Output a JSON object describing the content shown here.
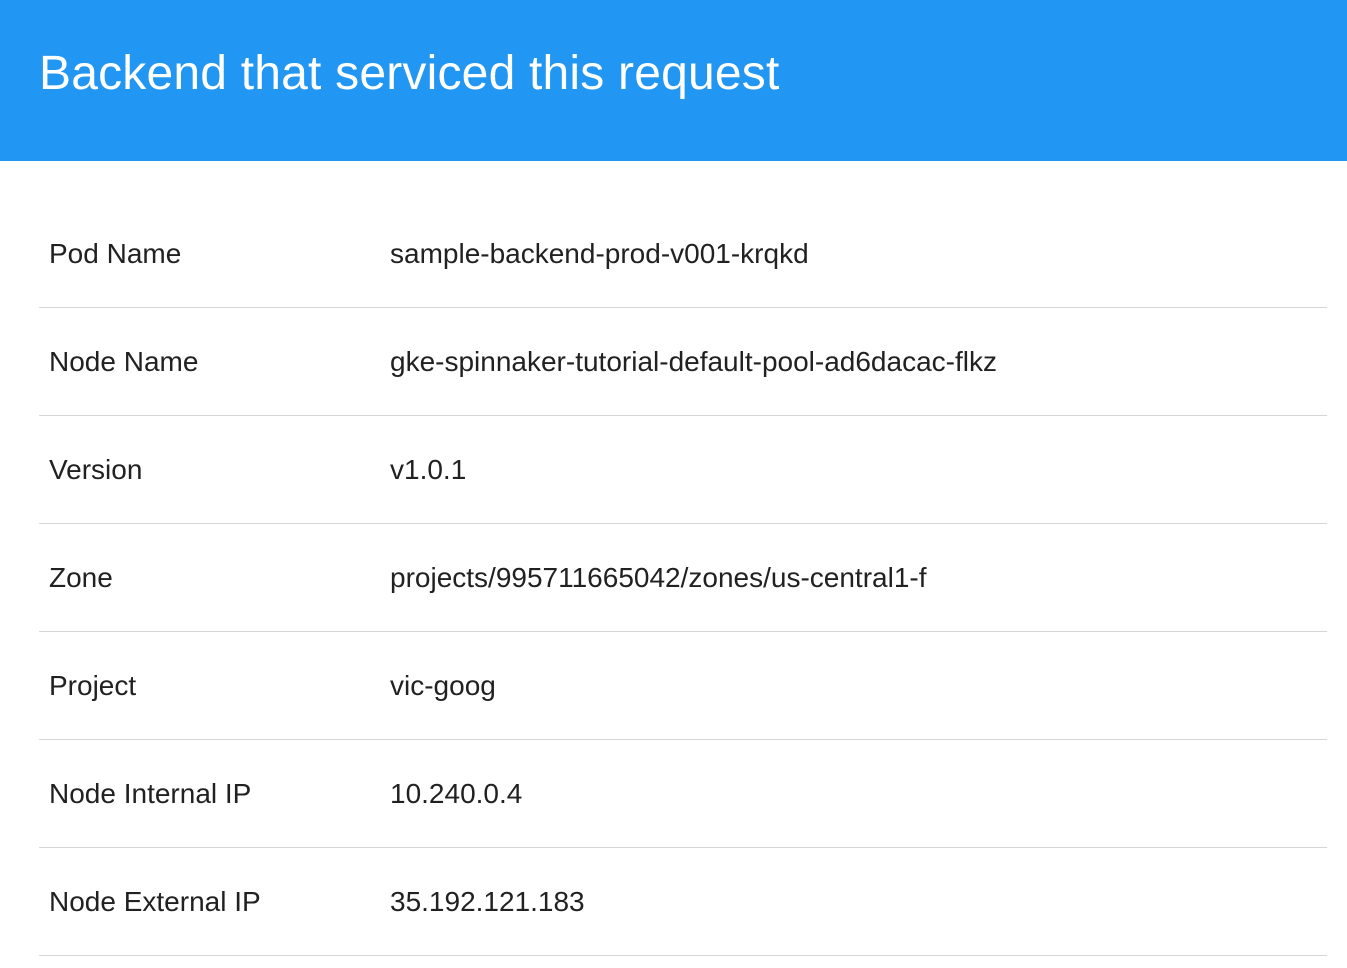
{
  "header": {
    "title": "Backend that serviced this request",
    "background_color": "#2196F3"
  },
  "details": {
    "rows": [
      {
        "label": "Pod Name",
        "value": "sample-backend-prod-v001-krqkd"
      },
      {
        "label": "Node Name",
        "value": "gke-spinnaker-tutorial-default-pool-ad6dacac-flkz"
      },
      {
        "label": "Version",
        "value": "v1.0.1"
      },
      {
        "label": "Zone",
        "value": "projects/995711665042/zones/us-central1-f"
      },
      {
        "label": "Project",
        "value": "vic-goog"
      },
      {
        "label": "Node Internal IP",
        "value": "10.240.0.4"
      },
      {
        "label": "Node External IP",
        "value": "35.192.121.183"
      }
    ]
  }
}
